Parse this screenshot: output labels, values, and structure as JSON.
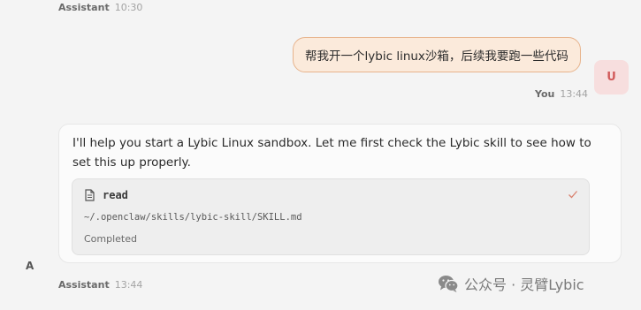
{
  "top_meta": {
    "name": "Assistant",
    "time": "10:30"
  },
  "user_message": {
    "text": "帮我开一个lybic linux沙箱，后续我要跑一些代码",
    "avatar": "U",
    "name": "You",
    "time": "13:44"
  },
  "assistant_message": {
    "text": "I'll help you start a Lybic Linux sandbox. Let me first check the Lybic skill to see how to set this up properly.",
    "avatar": "A",
    "name": "Assistant",
    "time": "13:44",
    "tool": {
      "icon": "document-icon",
      "name": "read",
      "path": "~/.openclaw/skills/lybic-skill/SKILL.md",
      "status": "Completed",
      "status_icon": "check-icon"
    }
  },
  "watermark": {
    "icon": "wechat-icon",
    "text": "公众号 · 灵臂Lybic"
  },
  "colors": {
    "background": "#f4f4f4",
    "user_bubble_bg": "#fbeadb",
    "user_bubble_border": "#e7b38c",
    "user_avatar_bg": "#f7dede",
    "user_avatar_fg": "#d15a5a",
    "check": "#d9826f"
  }
}
